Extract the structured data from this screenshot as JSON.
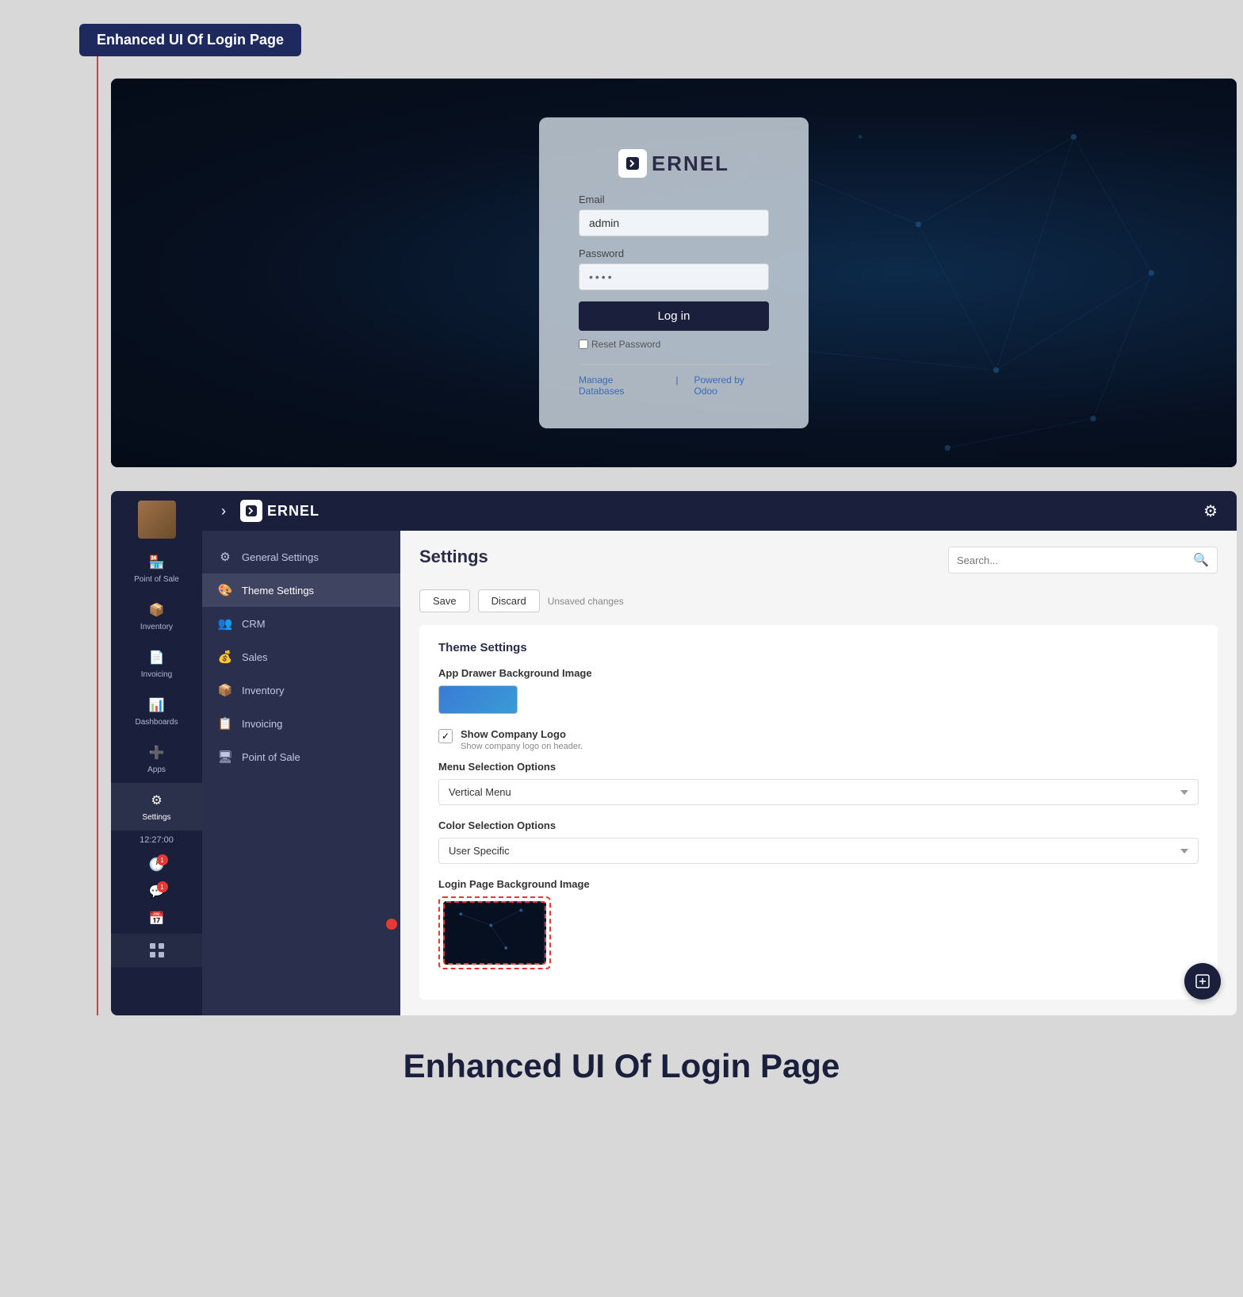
{
  "top_label": "Enhanced UI Of Login Page",
  "login_preview": {
    "logo_text": "ERNEL",
    "email_label": "Email",
    "email_value": "admin",
    "password_label": "Password",
    "password_value": "••••",
    "login_button": "Log in",
    "reset_password": "Reset Password",
    "manage_db": "Manage Databases",
    "powered_by": "Powered by Odoo"
  },
  "topbar": {
    "logo_text": "ERNEL",
    "settings_icon": "⚙"
  },
  "sidebar": {
    "items": [
      {
        "label": "Point of Sale",
        "icon": "🏪"
      },
      {
        "label": "Inventory",
        "icon": "📦"
      },
      {
        "label": "Invoicing",
        "icon": "📄"
      },
      {
        "label": "Dashboards",
        "icon": "📊"
      },
      {
        "label": "Apps",
        "icon": "➕"
      },
      {
        "label": "Settings",
        "icon": "⚙"
      }
    ],
    "time": "12:27:00",
    "badge1": "1",
    "badge2": "1"
  },
  "left_nav": {
    "items": [
      {
        "label": "General Settings",
        "icon": "⚙",
        "active": false
      },
      {
        "label": "Theme Settings",
        "icon": "🎨",
        "active": true
      },
      {
        "label": "CRM",
        "icon": "👥",
        "active": false
      },
      {
        "label": "Sales",
        "icon": "💰",
        "active": false
      },
      {
        "label": "Inventory",
        "icon": "📦",
        "active": false
      },
      {
        "label": "Invoicing",
        "icon": "📋",
        "active": false
      },
      {
        "label": "Point of Sale",
        "icon": "🖥",
        "active": false
      }
    ]
  },
  "settings": {
    "page_title": "Settings",
    "search_placeholder": "Search...",
    "save_label": "Save",
    "discard_label": "Discard",
    "unsaved_text": "Unsaved changes",
    "section_title": "Theme Settings",
    "bg_image_label": "App Drawer Background Image",
    "show_logo_label": "Show Company Logo",
    "show_logo_sub": "Show company logo on header.",
    "menu_options_label": "Menu Selection Options",
    "menu_options_value": "Vertical Menu",
    "color_options_label": "Color Selection Options",
    "color_options_value": "User Specific",
    "login_bg_label": "Login Page Background Image"
  },
  "bottom_title": "Enhanced UI Of Login Page"
}
